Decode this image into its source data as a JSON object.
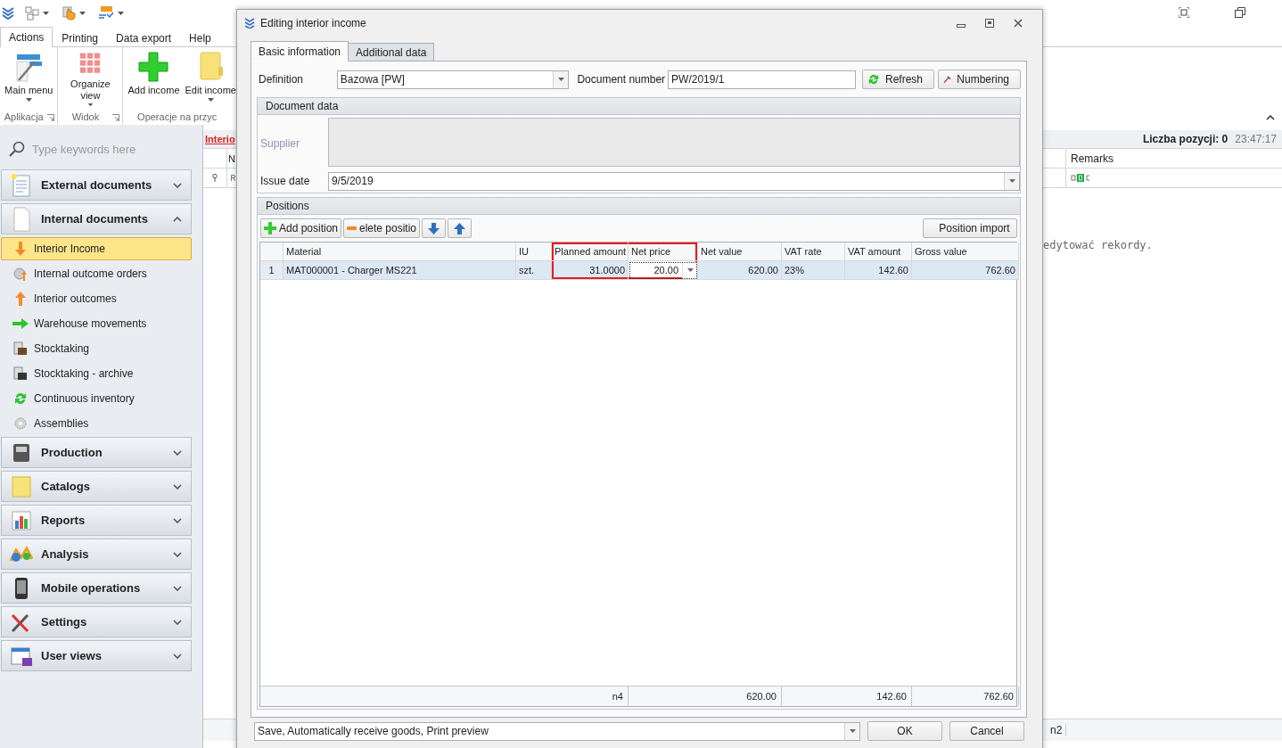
{
  "ribbon": {
    "tabs": [
      {
        "label": "Actions",
        "selected": true
      },
      {
        "label": "Printing",
        "selected": false
      },
      {
        "label": "Data export",
        "selected": false
      },
      {
        "label": "Help",
        "selected": false
      }
    ],
    "groups": [
      {
        "label": "Aplikacja",
        "launcher": true,
        "buttons": [
          {
            "label": "Main menu",
            "dropdown": true
          }
        ]
      },
      {
        "label": "Widok",
        "launcher": true,
        "buttons": [
          {
            "label": "Organize view",
            "dropdown": true
          }
        ]
      },
      {
        "label": "Operacje na przyc",
        "launcher": false,
        "buttons": [
          {
            "label": "Add income",
            "dropdown": false
          },
          {
            "label": "Edit income",
            "dropdown": true
          }
        ]
      }
    ]
  },
  "sidebar": {
    "search": {
      "placeholder": "Type keywords here"
    },
    "groups": [
      {
        "label": "External documents",
        "expanded": false
      },
      {
        "label": "Internal documents",
        "expanded": true,
        "items": [
          {
            "label": "Interior Income",
            "selected": true
          },
          {
            "label": "Internal outcome orders",
            "selected": false
          },
          {
            "label": "Interior outcomes",
            "selected": false
          },
          {
            "label": "Warehouse movements",
            "selected": false
          },
          {
            "label": "Stocktaking",
            "selected": false
          },
          {
            "label": "Stocktaking - archive",
            "selected": false
          },
          {
            "label": "Continuous inventory",
            "selected": false
          },
          {
            "label": "Assemblies",
            "selected": false
          }
        ]
      },
      {
        "label": "Production",
        "expanded": false
      },
      {
        "label": "Catalogs",
        "expanded": false
      },
      {
        "label": "Reports",
        "expanded": false
      },
      {
        "label": "Analysis",
        "expanded": false
      },
      {
        "label": "Mobile operations",
        "expanded": false
      },
      {
        "label": "Settings",
        "expanded": false
      },
      {
        "label": "User views",
        "expanded": false
      }
    ]
  },
  "content": {
    "tab_label": "Interio",
    "item_count": "Liczba pozycji: 0",
    "time": "23:47:17",
    "columns": [
      "N",
      "Remarks"
    ],
    "message": "edytować rekordy.",
    "footer": "n2"
  },
  "dialog": {
    "title": "Editing interior income",
    "tabs": [
      {
        "label": "Basic information",
        "selected": true
      },
      {
        "label": "Additional data",
        "selected": false
      }
    ],
    "definition": {
      "label": "Definition",
      "value": "Bazowa [PW]"
    },
    "document_number": {
      "label": "Document number",
      "value": "PW/2019/1"
    },
    "buttons": [
      {
        "kind": "refresh",
        "label": "Refresh"
      },
      {
        "kind": "numbering",
        "label": "Numbering"
      }
    ],
    "document_data": {
      "title": "Document data",
      "supplier": {
        "label": "Supplier",
        "disabled": true
      },
      "issue_date": {
        "label": "Issue date",
        "value": "9/5/2019"
      }
    },
    "positions": {
      "title": "Positions",
      "toolbar": [
        {
          "kind": "add",
          "label": "Add position"
        },
        {
          "kind": "delete",
          "label": "elete positio"
        },
        {
          "kind": "down"
        },
        {
          "kind": "up"
        }
      ],
      "import_button": "Position import",
      "columns": [
        {
          "label": "Material",
          "numeric": false,
          "highlighted": false
        },
        {
          "label": "IU",
          "numeric": false,
          "highlighted": false
        },
        {
          "label": "Planned amount",
          "numeric": true,
          "highlighted": true
        },
        {
          "label": "Net price",
          "numeric": true,
          "highlighted": true
        },
        {
          "label": "Net value",
          "numeric": true,
          "highlighted": false
        },
        {
          "label": "VAT rate",
          "numeric": false,
          "highlighted": false
        },
        {
          "label": "VAT amount",
          "numeric": true,
          "highlighted": false
        },
        {
          "label": "Gross value",
          "numeric": true,
          "highlighted": false
        }
      ],
      "rows": [
        {
          "number": "1",
          "selected": true,
          "cells": [
            {
              "text": "MAT000001 - Charger MS221",
              "editing": false
            },
            {
              "text": "szt.",
              "editing": false
            },
            {
              "text": "31.0000",
              "editing": false
            },
            {
              "text": "20.00",
              "editing": true
            },
            {
              "text": "620.00",
              "editing": false
            },
            {
              "text": "23%",
              "editing": false
            },
            {
              "text": "142.60",
              "editing": false
            },
            {
              "text": "762.60",
              "editing": false
            }
          ]
        }
      ],
      "summary_row": [
        {
          "kind": "planned_amount",
          "text": "n4"
        },
        {
          "kind": "net_value",
          "text": "620.00"
        },
        {
          "kind": "vat_amount",
          "text": "142.60"
        },
        {
          "kind": "gross_value",
          "text": "762.60"
        }
      ]
    },
    "action_combo": "Save, Automatically receive goods, Print preview",
    "footer_buttons": [
      "OK",
      "Cancel"
    ]
  }
}
